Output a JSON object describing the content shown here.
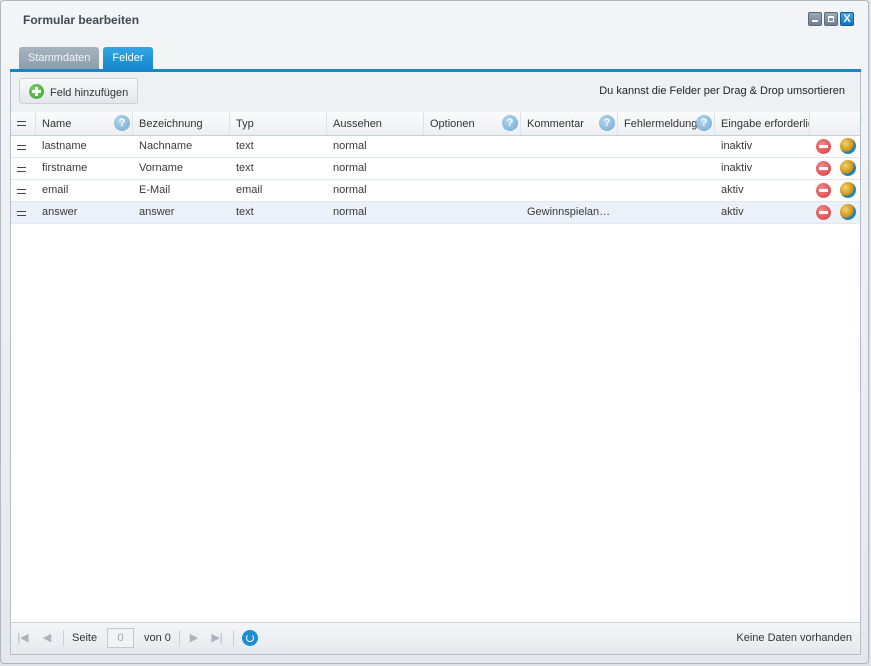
{
  "window": {
    "title": "Formular bearbeiten",
    "buttons": {
      "minimize_icon": "minimize-icon",
      "maximize_icon": "maximize-icon",
      "close_label": "X"
    }
  },
  "tabs": [
    {
      "label": "Stammdaten",
      "active": false
    },
    {
      "label": "Felder",
      "active": true
    }
  ],
  "toolbar": {
    "add_label": "Feld hinzufügen",
    "hint": "Du kannst die Felder per Drag & Drop umsortieren"
  },
  "grid": {
    "columns": [
      "Name",
      "Bezeichnung",
      "Typ",
      "Aussehen",
      "Optionen",
      "Kommentar",
      "Fehlermeldung",
      "Eingabe erforderlich"
    ],
    "help_icon": "?",
    "rows": [
      {
        "name": "lastname",
        "label": "Nachname",
        "type": "text",
        "appearance": "normal",
        "options": "",
        "comment": "",
        "error": "",
        "required": "inaktiv"
      },
      {
        "name": "firstname",
        "label": "Vorname",
        "type": "text",
        "appearance": "normal",
        "options": "",
        "comment": "",
        "error": "",
        "required": "inaktiv"
      },
      {
        "name": "email",
        "label": "E-Mail",
        "type": "email",
        "appearance": "normal",
        "options": "",
        "comment": "",
        "error": "",
        "required": "aktiv"
      },
      {
        "name": "answer",
        "label": "answer",
        "type": "text",
        "appearance": "normal",
        "options": "",
        "comment": "Gewinnspielantwort",
        "error": "",
        "required": "aktiv"
      }
    ]
  },
  "pager": {
    "page_label": "Seite",
    "page_value": "0",
    "of_label": "von 0",
    "status": "Keine Daten vorhanden"
  },
  "colors": {
    "accent": "#1787cc",
    "row_alt": "#eaf1f8",
    "delete": "#d9363a"
  }
}
